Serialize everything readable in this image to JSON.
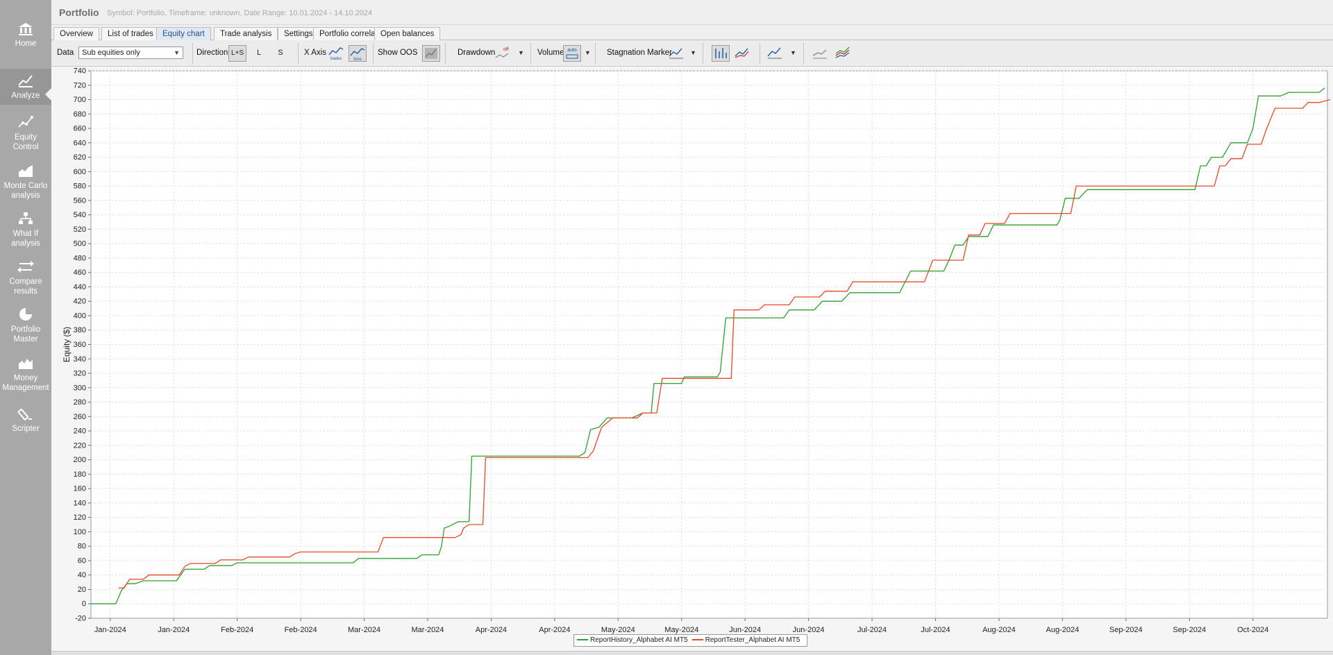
{
  "app": {
    "title": "Portfolio",
    "info": "Symbol: Portfolio, Timeframe: unknown, Date Range: 10.01.2024 - 14.10.2024"
  },
  "sidebar": {
    "items": [
      {
        "label_lines": [
          "Home"
        ],
        "icon": "home-icon",
        "active": false
      },
      {
        "label_lines": [
          "Analyze"
        ],
        "icon": "analyze-icon",
        "active": true
      },
      {
        "label_lines": [
          "Equity",
          "Control"
        ],
        "icon": "equity-control-icon",
        "active": false
      },
      {
        "label_lines": [
          "Monte Carlo",
          "analysis"
        ],
        "icon": "monte-carlo-icon",
        "active": false
      },
      {
        "label_lines": [
          "What If",
          "analysis"
        ],
        "icon": "what-if-icon",
        "active": false
      },
      {
        "label_lines": [
          "Compare",
          "results"
        ],
        "icon": "compare-icon",
        "active": false
      },
      {
        "label_lines": [
          "Portfolio",
          "Master"
        ],
        "icon": "portfolio-master-icon",
        "active": false
      },
      {
        "label_lines": [
          "Money",
          "Management"
        ],
        "icon": "money-management-icon",
        "active": false
      },
      {
        "label_lines": [
          "Scripter"
        ],
        "icon": "scripter-icon",
        "active": false
      }
    ]
  },
  "tabs": [
    {
      "label": "Overview",
      "active": false
    },
    {
      "label": "List of trades",
      "active": false
    },
    {
      "label": "Equity chart",
      "active": true
    },
    {
      "label": "Trade analysis",
      "active": false
    },
    {
      "label": "Settings",
      "active": false
    },
    {
      "label": "Portfolio correlation",
      "active": false
    },
    {
      "label": "Open balances",
      "active": false
    }
  ],
  "toolbar": {
    "data_label": "Data",
    "data_value": "Sub equities only",
    "direction_label": "Direction",
    "direction_ls": "L+S",
    "direction_l": "L",
    "direction_s": "S",
    "xaxis_label": "X Axis",
    "xaxis_trades": "trades",
    "xaxis_time": "time",
    "show_oos_label": "Show OOS",
    "drawdown_label": "Drawdown",
    "drawdown_value": "off",
    "volume_label": "Volume",
    "volume_value": "auto",
    "stagnation_label": "Stagnation Marker"
  },
  "chart_data": {
    "type": "line",
    "ylabel": "Equity ($)",
    "ylim": [
      -20,
      740
    ],
    "yticks": [
      -20,
      0,
      20,
      40,
      60,
      80,
      100,
      120,
      140,
      160,
      180,
      200,
      220,
      240,
      260,
      280,
      300,
      320,
      340,
      360,
      380,
      400,
      420,
      440,
      460,
      480,
      500,
      520,
      540,
      560,
      580,
      600,
      620,
      640,
      660,
      680,
      700,
      720,
      740
    ],
    "xlim": [
      0,
      281
    ],
    "xticks": [
      {
        "x": 7,
        "label": "Jan-2024"
      },
      {
        "x": 30,
        "label": "Jan-2024"
      },
      {
        "x": 53,
        "label": "Feb-2024"
      },
      {
        "x": 76,
        "label": "Feb-2024"
      },
      {
        "x": 99,
        "label": "Mar-2024"
      },
      {
        "x": 122,
        "label": "Mar-2024"
      },
      {
        "x": 145,
        "label": "Apr-2024"
      },
      {
        "x": 168,
        "label": "Apr-2024"
      },
      {
        "x": 191,
        "label": "May-2024"
      },
      {
        "x": 214,
        "label": "May-2024"
      },
      {
        "x": 237,
        "label": "Jun-2024"
      },
      {
        "x": 260,
        "label": "Jun-2024"
      },
      {
        "x": 283,
        "label": "Jul-2024"
      },
      {
        "x": 306,
        "label": "Jul-2024"
      },
      {
        "x": 329,
        "label": "Aug-2024"
      },
      {
        "x": 352,
        "label": "Aug-2024"
      },
      {
        "x": 375,
        "label": "Sep-2024"
      },
      {
        "x": 398,
        "label": "Sep-2024"
      },
      {
        "x": 421,
        "label": "Oct-2024"
      }
    ],
    "grid": true,
    "legend_position": "bottom-center",
    "series": [
      {
        "name": "ReportHistory_Alphabet AI MT5",
        "color": "#2e9e2e",
        "points": [
          [
            0,
            0
          ],
          [
            9,
            0
          ],
          [
            11,
            18
          ],
          [
            13,
            28
          ],
          [
            16,
            28
          ],
          [
            19,
            32
          ],
          [
            31,
            32
          ],
          [
            34,
            48
          ],
          [
            41,
            48
          ],
          [
            43,
            53
          ],
          [
            51,
            53
          ],
          [
            53,
            57
          ],
          [
            95,
            57
          ],
          [
            97,
            63
          ],
          [
            118,
            63
          ],
          [
            120,
            68
          ],
          [
            126,
            68
          ],
          [
            127,
            80
          ],
          [
            128,
            105
          ],
          [
            130,
            108
          ],
          [
            133,
            114
          ],
          [
            137,
            114
          ],
          [
            138,
            205
          ],
          [
            177,
            205
          ],
          [
            179,
            210
          ],
          [
            181,
            242
          ],
          [
            184,
            245
          ],
          [
            187,
            258
          ],
          [
            196,
            258
          ],
          [
            200,
            265
          ],
          [
            203,
            265
          ],
          [
            204,
            306
          ],
          [
            214,
            306
          ],
          [
            215,
            315
          ],
          [
            227,
            315
          ],
          [
            228,
            322
          ],
          [
            230,
            397
          ],
          [
            251,
            397
          ],
          [
            253,
            408
          ],
          [
            262,
            408
          ],
          [
            265,
            420
          ],
          [
            272,
            420
          ],
          [
            275,
            432
          ],
          [
            293,
            432
          ],
          [
            297,
            462
          ],
          [
            309,
            462
          ],
          [
            311,
            478
          ],
          [
            313,
            498
          ],
          [
            316,
            498
          ],
          [
            318,
            510
          ],
          [
            325,
            510
          ],
          [
            327,
            526
          ],
          [
            350,
            526
          ],
          [
            351,
            532
          ],
          [
            353,
            563
          ],
          [
            358,
            563
          ],
          [
            361,
            575
          ],
          [
            400,
            575
          ],
          [
            402,
            608
          ],
          [
            404,
            608
          ],
          [
            406,
            620
          ],
          [
            410,
            620
          ],
          [
            413,
            640
          ],
          [
            419,
            640
          ],
          [
            421,
            660
          ],
          [
            423,
            705
          ],
          [
            431,
            705
          ],
          [
            434,
            710
          ],
          [
            445,
            710
          ],
          [
            447,
            716
          ]
        ]
      },
      {
        "name": "ReportTester_Alphabet AI MT5",
        "color": "#e8472a",
        "points": [
          [
            10,
            22
          ],
          [
            12,
            22
          ],
          [
            14,
            34
          ],
          [
            19,
            34
          ],
          [
            21,
            40
          ],
          [
            32,
            40
          ],
          [
            34,
            52
          ],
          [
            36,
            56
          ],
          [
            45,
            56
          ],
          [
            47,
            61
          ],
          [
            55,
            61
          ],
          [
            57,
            65
          ],
          [
            72,
            65
          ],
          [
            74,
            70
          ],
          [
            76,
            72
          ],
          [
            104,
            72
          ],
          [
            106,
            92
          ],
          [
            132,
            92
          ],
          [
            134,
            96
          ],
          [
            135,
            105
          ],
          [
            137,
            110
          ],
          [
            142,
            110
          ],
          [
            143,
            203
          ],
          [
            180,
            203
          ],
          [
            182,
            212
          ],
          [
            185,
            245
          ],
          [
            189,
            258
          ],
          [
            198,
            258
          ],
          [
            200,
            265
          ],
          [
            205,
            265
          ],
          [
            207,
            313
          ],
          [
            224,
            313
          ],
          [
            226,
            313
          ],
          [
            232,
            313
          ],
          [
            233,
            408
          ],
          [
            242,
            408
          ],
          [
            244,
            415
          ],
          [
            253,
            415
          ],
          [
            255,
            426
          ],
          [
            264,
            426
          ],
          [
            266,
            434
          ],
          [
            274,
            434
          ],
          [
            276,
            447
          ],
          [
            302,
            447
          ],
          [
            305,
            477
          ],
          [
            316,
            477
          ],
          [
            318,
            512
          ],
          [
            322,
            512
          ],
          [
            324,
            528
          ],
          [
            331,
            528
          ],
          [
            333,
            542
          ],
          [
            355,
            542
          ],
          [
            357,
            580
          ],
          [
            407,
            580
          ],
          [
            409,
            608
          ],
          [
            411,
            608
          ],
          [
            413,
            618
          ],
          [
            417,
            618
          ],
          [
            419,
            638
          ],
          [
            424,
            638
          ],
          [
            426,
            660
          ],
          [
            429,
            688
          ],
          [
            439,
            688
          ],
          [
            441,
            696
          ],
          [
            445,
            696
          ],
          [
            449,
            700
          ]
        ]
      }
    ]
  }
}
